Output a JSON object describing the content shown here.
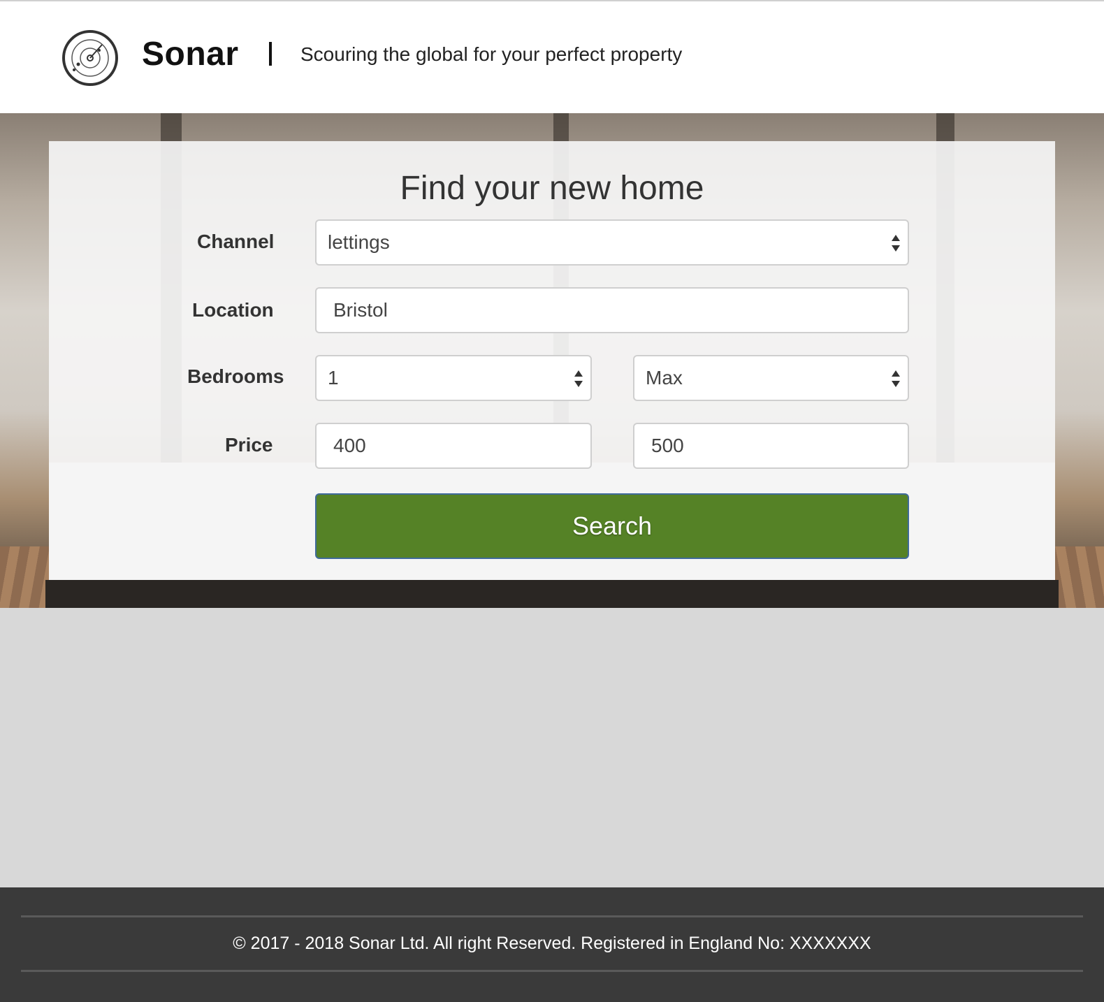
{
  "header": {
    "brand": "Sonar",
    "tagline": "Scouring the global for your perfect property"
  },
  "search_form": {
    "title": "Find your new home",
    "channel": {
      "label": "Channel",
      "value": "lettings"
    },
    "location": {
      "label": "Location",
      "value": "Bristol"
    },
    "bedrooms": {
      "label": "Bedrooms",
      "min_value": "1",
      "max_value": "Max"
    },
    "price": {
      "label": "Price",
      "min_value": "400",
      "max_value": "500"
    },
    "search_button": "Search"
  },
  "footer": {
    "copyright": "© 2017 - 2018 Sonar Ltd. All right Reserved. Registered in England No: XXXXXXX"
  },
  "colors": {
    "search_button": "#558226",
    "footer_bg": "#3a3a3a",
    "page_bg": "#d8d8d8"
  }
}
